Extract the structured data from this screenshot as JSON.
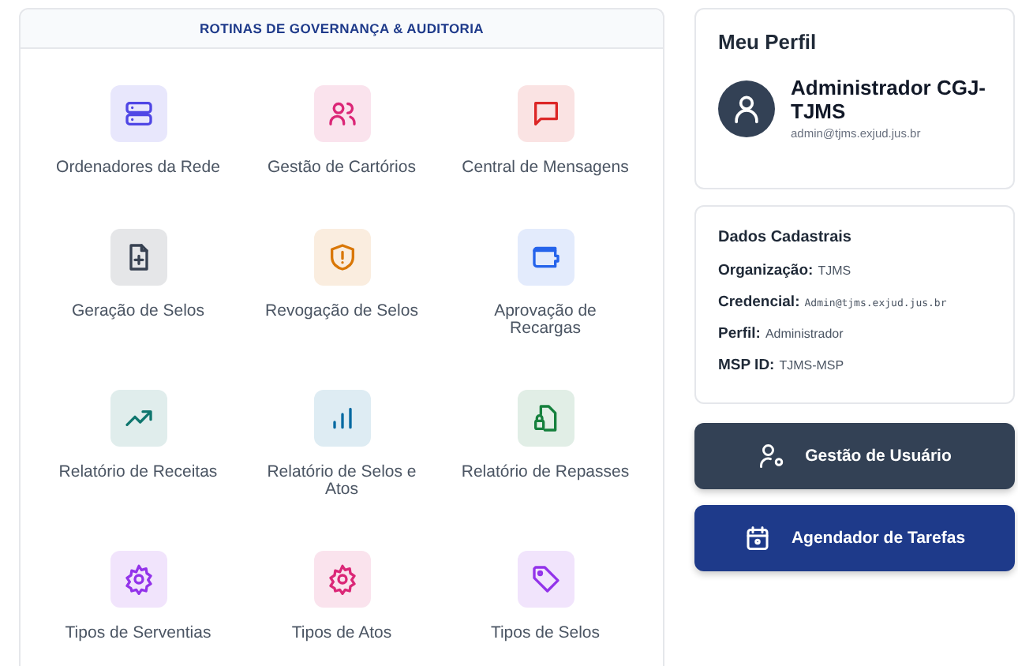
{
  "panel": {
    "title": "ROTINAS DE GOVERNANÇA & AUDITORIA",
    "tiles": [
      {
        "label": "Ordenadores da Rede",
        "kind": "server",
        "color": "#4f46e5"
      },
      {
        "label": "Gestão de Cartórios",
        "kind": "users",
        "color": "#db2777"
      },
      {
        "label": "Central de Mensagens",
        "kind": "message",
        "color": "#dc2626"
      },
      {
        "label": "Geração de Selos",
        "kind": "fileplus",
        "color": "#374151"
      },
      {
        "label": "Revogação de Selos",
        "kind": "shield",
        "color": "#d97706"
      },
      {
        "label": "Aprovação de Recargas",
        "kind": "wallet",
        "color": "#2563eb"
      },
      {
        "label": "Relatório de Receitas",
        "kind": "trend",
        "color": "#0f766e"
      },
      {
        "label": "Relatório de Selos e Atos",
        "kind": "bars",
        "color": "#0369a1"
      },
      {
        "label": "Relatório de Repasses",
        "kind": "filelock",
        "color": "#15803d"
      },
      {
        "label": "Tipos de Serventias",
        "kind": "gear",
        "color": "#9333ea"
      },
      {
        "label": "Tipos de Atos",
        "kind": "gear",
        "color": "#db2777"
      },
      {
        "label": "Tipos de Selos",
        "kind": "tag",
        "color": "#9333ea"
      }
    ]
  },
  "profile": {
    "title": "Meu Perfil",
    "name": "Administrador CGJ-TJMS",
    "email": "admin@tjms.exjud.jus.br"
  },
  "details": {
    "title": "Dados Cadastrais",
    "fields": [
      {
        "label": "Organização:",
        "value": "TJMS",
        "kind": "text"
      },
      {
        "label": "Credencial:",
        "value": "Admin@tjms.exjud.jus.br",
        "kind": "code"
      },
      {
        "label": "Perfil:",
        "value": "Administrador",
        "kind": "text"
      },
      {
        "label": "MSP ID:",
        "value": "TJMS-MSP",
        "kind": "text"
      }
    ]
  },
  "actions": [
    {
      "label": "Gestão de Usuário",
      "kind": "users"
    },
    {
      "label": "Agendador de Tarefas",
      "kind": "scheduler"
    }
  ]
}
